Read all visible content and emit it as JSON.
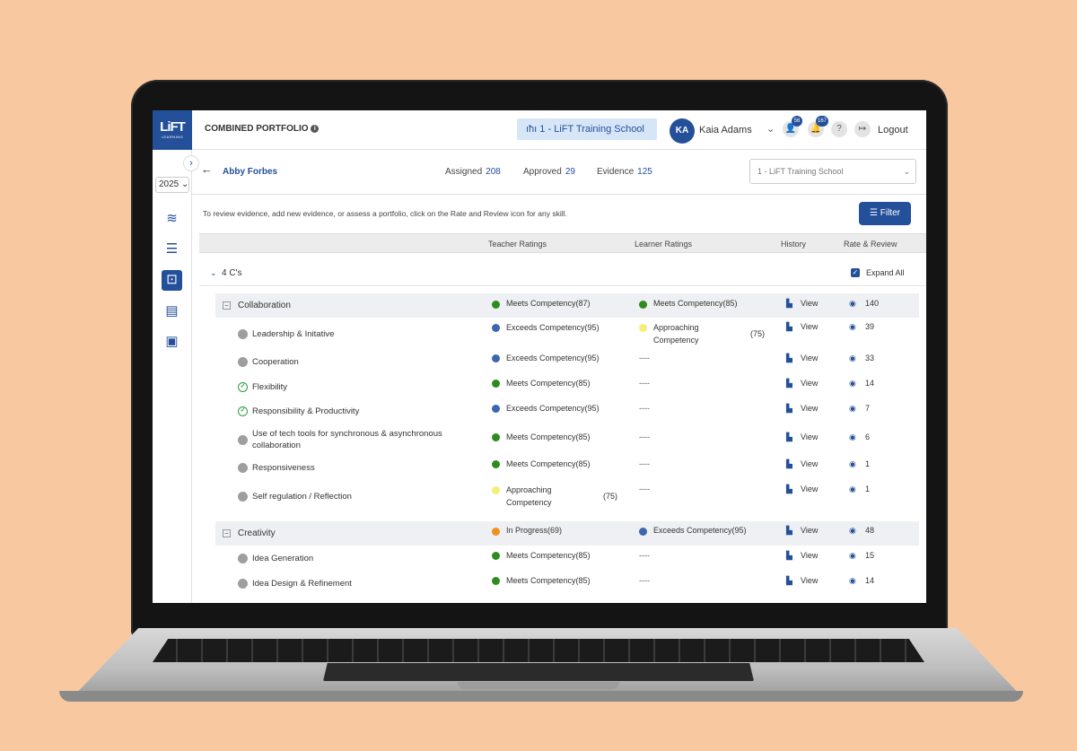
{
  "app": {
    "logo": "LiFT",
    "logo_sub": "LEARNING",
    "title": "COMBINED PORTFOLIO",
    "school": "1 - LiFT Training School",
    "user_initials": "KA",
    "user_name": "Kaia Adams",
    "badge_users": "56",
    "badge_alerts": "167",
    "logout": "Logout",
    "year": "2025"
  },
  "student": {
    "back": "←",
    "name": "Abby Forbes",
    "assigned_label": "Assigned",
    "assigned": "208",
    "approved_label": "Approved",
    "approved": "29",
    "evidence_label": "Evidence",
    "evidence": "125",
    "school_select": "1 - LiFT Training School"
  },
  "instructions": "To review evidence, add new evidence, or assess a portfolio, click on the Rate and Review icon for any skill.",
  "filter_label": "Filter",
  "columns": {
    "teacher": "Teacher Ratings",
    "learner": "Learner Ratings",
    "history": "History",
    "rate": "Rate & Review"
  },
  "group": {
    "name": "4 C's",
    "expand_all": "Expand All"
  },
  "categories": [
    {
      "name": "Collaboration",
      "teacher": "Meets Competency(87)",
      "learner": "Meets Competency(85)",
      "count": "140",
      "skills": [
        {
          "name": "Leadership & Initative",
          "teacher": "Exceeds Competency(95)",
          "learner_a": "Approaching",
          "learner_b": "Competency",
          "learner_score": "(75)",
          "count": "39"
        },
        {
          "name": "Cooperation",
          "teacher": "Exceeds Competency(95)",
          "learner": "----",
          "count": "33"
        },
        {
          "name": "Flexibility",
          "teacher": "Meets Competency(85)",
          "learner": "----",
          "count": "14"
        },
        {
          "name": "Responsibility & Productivity",
          "teacher": "Exceeds Competency(95)",
          "learner": "----",
          "count": "7"
        },
        {
          "name": "Use of tech tools for synchronous & asynchronous collaboration",
          "teacher": "Meets Competency(85)",
          "learner": "----",
          "count": "6"
        },
        {
          "name": "Responsiveness",
          "teacher": "Meets Competency(85)",
          "learner": "----",
          "count": "1"
        },
        {
          "name": "Self regulation / Reflection",
          "teacher_a": "Approaching",
          "teacher_b": "Competency",
          "teacher_score": "(75)",
          "learner": "----",
          "count": "1"
        }
      ]
    },
    {
      "name": "Creativity",
      "teacher": "In Progress(69)",
      "learner": "Exceeds Competency(95)",
      "count": "48",
      "skills": [
        {
          "name": "Idea Generation",
          "teacher": "Meets Competency(85)",
          "learner": "----",
          "count": "15"
        },
        {
          "name": "Idea Design & Refinement",
          "teacher": "Meets Competency(85)",
          "learner": "----",
          "count": "14"
        }
      ]
    }
  ],
  "view_label": "View",
  "colors": {
    "brand": "#24509a",
    "meets": "#2e8b1e",
    "exceeds": "#3d66b0",
    "approaching": "#f2ef7a",
    "in_progress": "#f0921c",
    "background": "#f8c9a0"
  }
}
